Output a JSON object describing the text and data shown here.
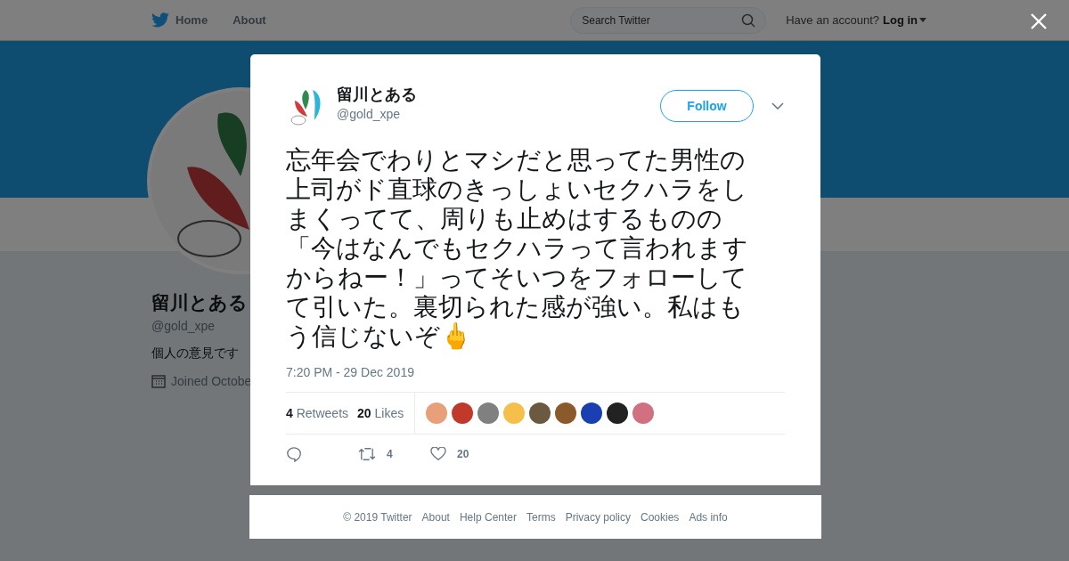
{
  "nav": {
    "items": [
      {
        "label": "Home"
      },
      {
        "label": "About"
      }
    ],
    "search": {
      "placeholder": "Search Twitter"
    },
    "account_prompt": "Have an account?",
    "login": "Log in"
  },
  "profile": {
    "name": "留川とある",
    "handle": "@gold_xpe",
    "bio": "個人の意見です",
    "joined": "Joined Octobe"
  },
  "tweet": {
    "author": {
      "name": "留川とある",
      "handle": "@gold_xpe"
    },
    "follow": "Follow",
    "text": "忘年会でわりとマシだと思ってた男性の上司がド直球のきっしょいセクハラをしまくってて、周りも止めはするものの「今はなんでもセクハラって言われますからねー！」ってそいつをフォローしてて引いた。裏切られた感が強い。私はもう信じないぞ🖕",
    "time": "7:20 PM - 29 Dec 2019",
    "stats": [
      {
        "count": "4",
        "label": "Retweets"
      },
      {
        "count": "20",
        "label": "Likes"
      }
    ],
    "liked_by": [
      {
        "color": "#e8a07a"
      },
      {
        "color": "#c0392b"
      },
      {
        "color": "#808080"
      },
      {
        "color": "#f5c04a"
      },
      {
        "color": "#6b5a40"
      },
      {
        "color": "#8a5a2a"
      },
      {
        "color": "#1a3fb0"
      },
      {
        "color": "#222222"
      },
      {
        "color": "#d07080"
      }
    ],
    "actions": [
      {
        "kind": "reply"
      },
      {
        "kind": "retweet",
        "count": "4"
      },
      {
        "kind": "like",
        "count": "20"
      }
    ]
  },
  "footer": [
    "© 2019 Twitter",
    "About",
    "Help Center",
    "Terms",
    "Privacy policy",
    "Cookies",
    "Ads info"
  ]
}
